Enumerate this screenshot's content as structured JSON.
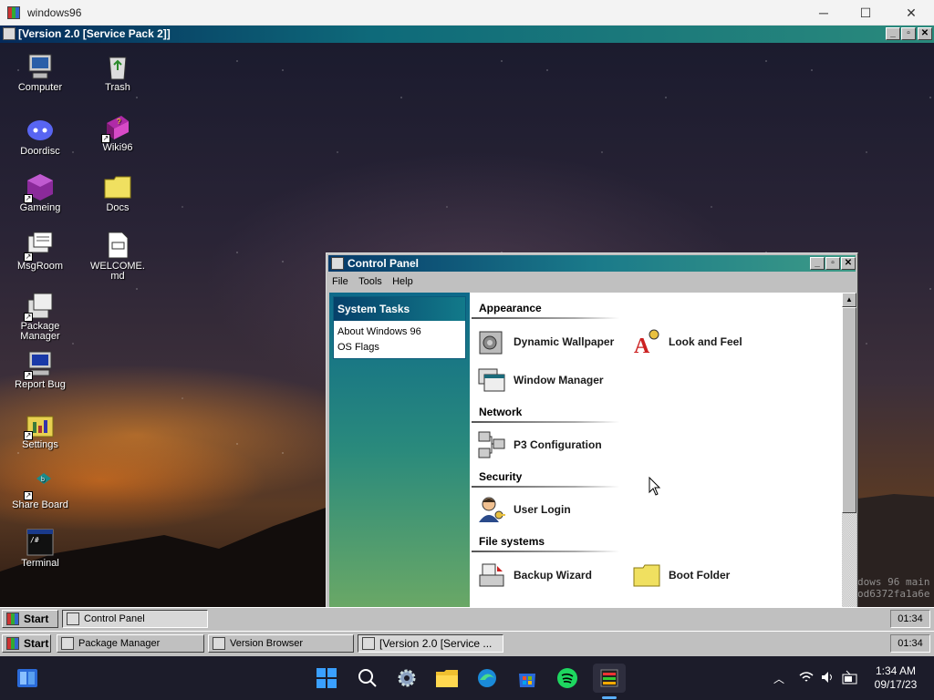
{
  "host": {
    "title": "windows96",
    "minimize": "─",
    "maximize": "☐",
    "close": "✕"
  },
  "vm": {
    "title": "[Version 2.0 [Service Pack 2]]",
    "btn_min": "_",
    "btn_max": "▫",
    "btn_close": "✕"
  },
  "desktop": {
    "icons": [
      {
        "label": "Computer"
      },
      {
        "label": "Trash"
      },
      {
        "label": "Doordisc"
      },
      {
        "label": "Wiki96"
      },
      {
        "label": "Gameing"
      },
      {
        "label": "Docs"
      },
      {
        "label": "MsgRoom"
      },
      {
        "label": "WELCOME.md"
      },
      {
        "label": "Package Manager"
      },
      {
        "label": "Report Bug"
      },
      {
        "label": "Settings"
      },
      {
        "label": "Share Board"
      },
      {
        "label": "Terminal"
      }
    ],
    "watermark_line1": "dows 96 main",
    "watermark_line2": "od6372fa1a6e"
  },
  "control_panel": {
    "title": "Control Panel",
    "menu": [
      "File",
      "Tools",
      "Help"
    ],
    "system_tasks": {
      "title": "System Tasks",
      "items": [
        "About Windows 96",
        "OS Flags"
      ]
    },
    "sections": {
      "appearance": {
        "title": "Appearance",
        "items": [
          "Dynamic Wallpaper",
          "Look and Feel",
          "Window Manager"
        ]
      },
      "network": {
        "title": "Network",
        "items": [
          "P3 Configuration"
        ]
      },
      "security": {
        "title": "Security",
        "items": [
          "User Login"
        ]
      },
      "file_systems": {
        "title": "File systems",
        "items": [
          "Backup Wizard",
          "Boot Folder"
        ]
      }
    }
  },
  "taskbar_inner": {
    "start": "Start",
    "window": "Control Panel",
    "clock": "01:34"
  },
  "taskbar_outer": {
    "start": "Start",
    "windows": [
      "Package Manager",
      "Version Browser",
      "[Version 2.0 [Service ..."
    ],
    "clock": "01:34"
  },
  "win11": {
    "time": "1:34 AM",
    "date": "09/17/23"
  }
}
